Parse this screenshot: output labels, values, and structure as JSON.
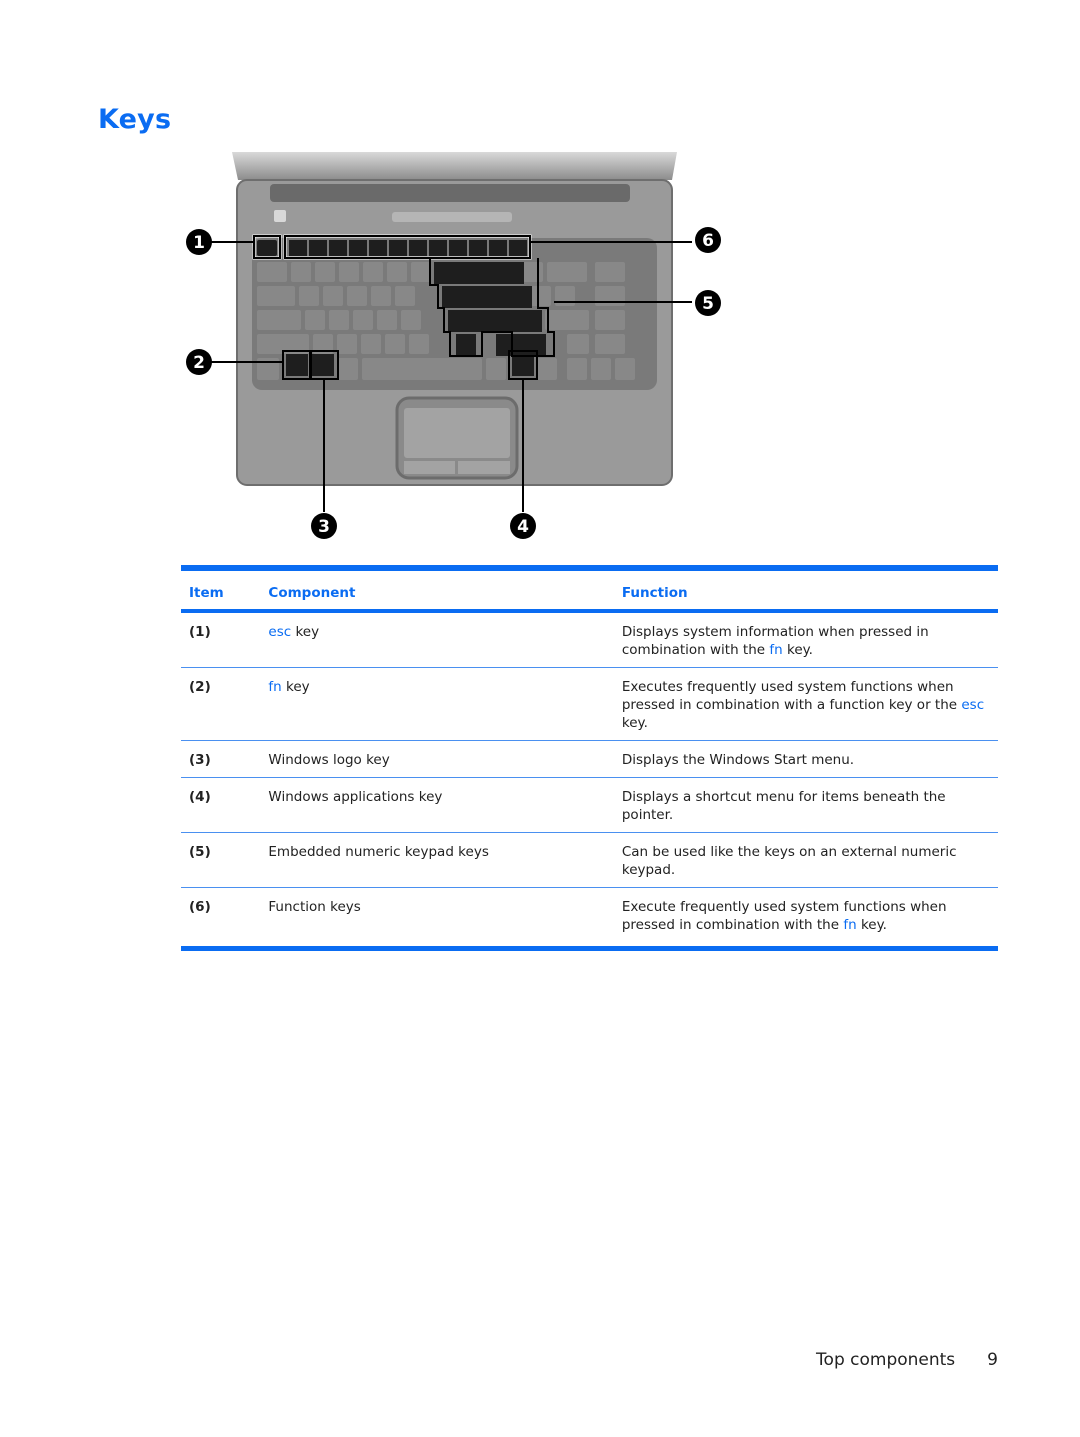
{
  "page": {
    "title": "Keys",
    "footer": {
      "section": "Top components",
      "page_number": "9"
    }
  },
  "figure": {
    "description": "Laptop keyboard top view with callouts",
    "callouts": [
      "1",
      "2",
      "3",
      "4",
      "5",
      "6"
    ]
  },
  "table": {
    "headers": {
      "item": "Item",
      "component": "Component",
      "function": "Function"
    },
    "accent_color": "#0a6cf2",
    "rows": [
      {
        "item": "(1)",
        "component_kw": "esc",
        "component_rest": " key",
        "function_parts": [
          "Displays system information when pressed in combination with the ",
          "fn",
          " key."
        ]
      },
      {
        "item": "(2)",
        "component_kw": "fn",
        "component_rest": " key",
        "function_parts": [
          "Executes frequently used system functions when pressed in combination with a function key or the ",
          "esc",
          " key."
        ]
      },
      {
        "item": "(3)",
        "component_kw": "",
        "component_rest": "Windows logo key",
        "function_parts": [
          "Displays the Windows Start menu.",
          "",
          ""
        ]
      },
      {
        "item": "(4)",
        "component_kw": "",
        "component_rest": "Windows applications key",
        "function_parts": [
          "Displays a shortcut menu for items beneath the pointer.",
          "",
          ""
        ]
      },
      {
        "item": "(5)",
        "component_kw": "",
        "component_rest": "Embedded numeric keypad keys",
        "function_parts": [
          "Can be used like the keys on an external numeric keypad.",
          "",
          ""
        ]
      },
      {
        "item": "(6)",
        "component_kw": "",
        "component_rest": "Function keys",
        "function_parts": [
          "Execute frequently used system functions when pressed in combination with the ",
          "fn",
          " key."
        ]
      }
    ]
  }
}
